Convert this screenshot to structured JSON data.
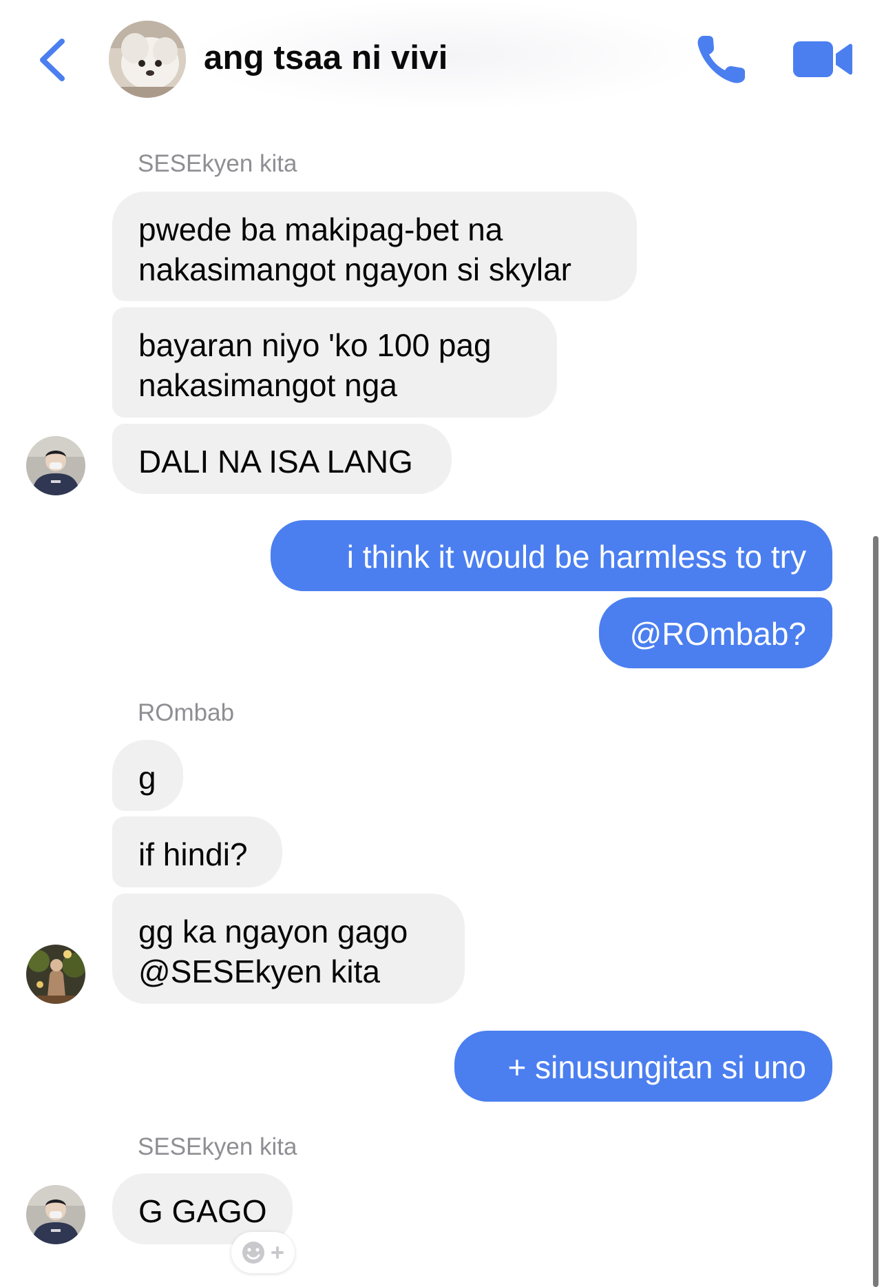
{
  "header": {
    "title": "ang tsaa ni vivi",
    "back_icon": "chevron-left-icon",
    "call_icon": "phone-icon",
    "video_icon": "video-camera-icon",
    "accent_color": "#4b7ff0"
  },
  "messages": {
    "group1": {
      "sender": "SESEkyen kita",
      "lines": [
        [
          "pwede ba makipag-bet na",
          "nakasimangot ngayon si skylar"
        ],
        [
          "bayaran niyo 'ko 100 pag",
          "nakasimangot nga"
        ],
        [
          "DALI NA ISA LANG"
        ]
      ]
    },
    "out1": [
      "i think it would be harmless to try",
      "@ROmbab?"
    ],
    "group2": {
      "sender": "ROmbab",
      "lines": [
        [
          "g"
        ],
        [
          "if hindi?"
        ],
        [
          "gg ka ngayon gago",
          "@SESEkyen kita"
        ]
      ]
    },
    "out2": [
      "+ sinusungitan si uno"
    ],
    "group3": {
      "sender": "SESEkyen kita",
      "lines": [
        [
          "G GAGO"
        ]
      ]
    }
  },
  "colors": {
    "incoming_bubble": "#f0f0f0",
    "outgoing_bubble": "#4b7ff0",
    "sender_name": "#8e8e93"
  }
}
